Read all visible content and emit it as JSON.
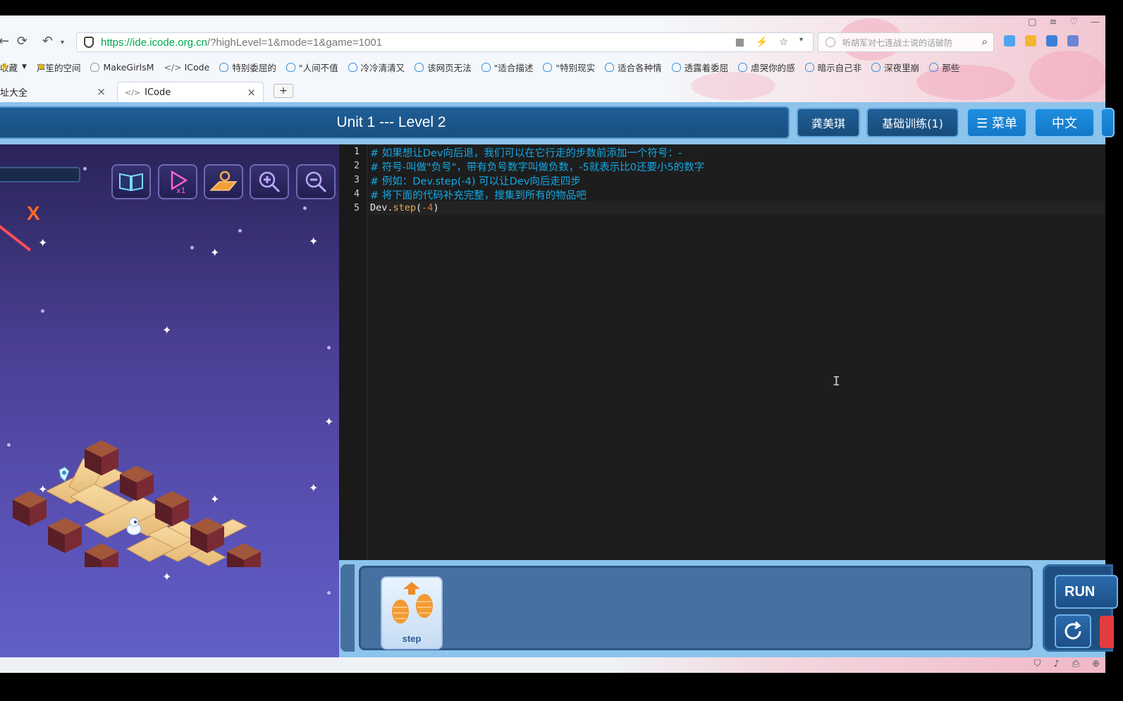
{
  "browser": {
    "url_host": "https://ide.icode.org.cn",
    "url_rest": "/?highLevel=1&mode=1&game=1001",
    "search_placeholder": "听胡军对七连战士说的话破防",
    "bookmarks": [
      "收藏",
      "声笙的空间",
      "MakeGirlsM",
      "ICode",
      "特别委屈的",
      "\"人间不值",
      "冷冷清清又",
      "该网页无法",
      "\"适合描述",
      "\"特别现实",
      "适合各种情",
      "透露着委屈",
      "虐哭你的感",
      "暗示自己非",
      "深夜里崩",
      "那些"
    ],
    "tabs": [
      {
        "label": "址大全"
      },
      {
        "label": "ICode"
      }
    ],
    "new_tab": "+"
  },
  "header": {
    "title": "Unit 1 --- Level 2",
    "user": "龚美琪",
    "course": "基础训练(1)",
    "menu": "☰ 菜单",
    "language": "中文"
  },
  "game": {
    "target_marker": "X",
    "tools": [
      "book-icon",
      "replay-icon",
      "map-grid-icon",
      "zoom-in-icon",
      "zoom-out-icon"
    ]
  },
  "editor": {
    "line_numbers": [
      "1",
      "2",
      "3",
      "4",
      "5"
    ],
    "lines": [
      "# 如果想让Dev向后退，我们可以在它行走的步数前添加一个符号：-",
      "# 符号-叫做\"负号\"，带有负号数字叫做负数，-5就表示比0还要小5的数字",
      "# 例如：Dev.step(-4) 可以让Dev向后走四步",
      "# 将下面的代码补充完整，搜集到所有的物品吧"
    ],
    "code": {
      "obj": "Dev.",
      "fn": "step",
      "open": "(",
      "arg": "-4",
      "close": ")"
    },
    "cursor": "I"
  },
  "palette": {
    "step_label": "step",
    "run_label": "RUN"
  },
  "colors": {
    "comment": "#14a9e6",
    "header_bg": "#8ec3eb",
    "title_bar": "#1a4f80",
    "target": "#ff6b2a"
  }
}
